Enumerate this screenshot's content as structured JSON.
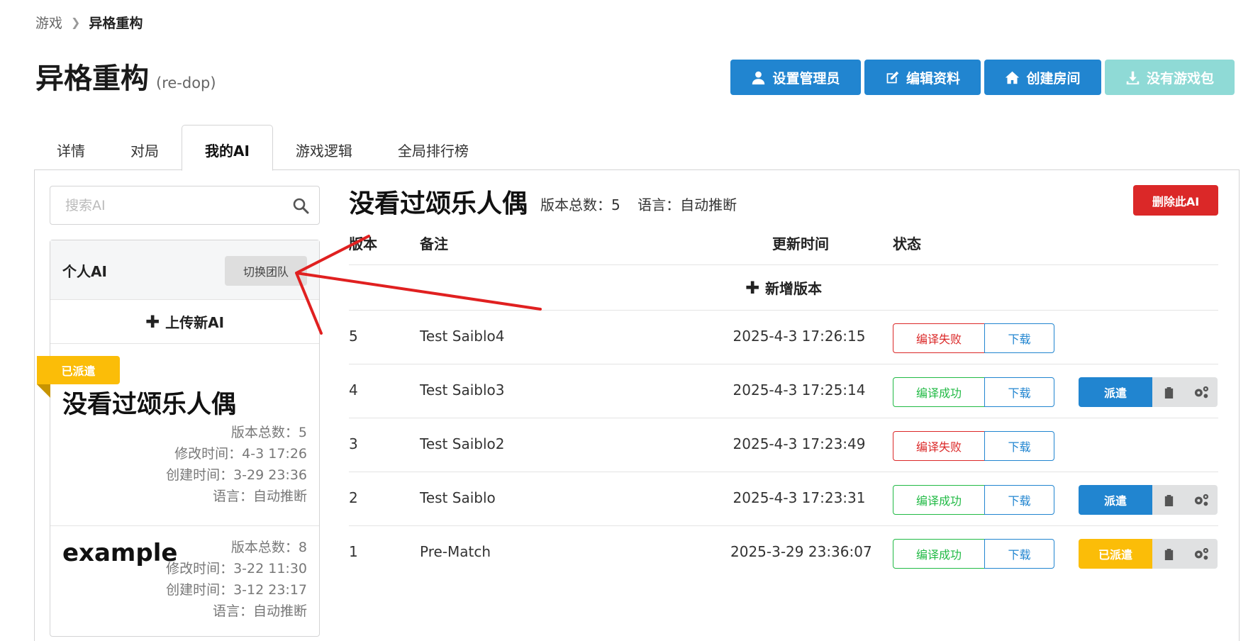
{
  "breadcrumb": {
    "parent": "游戏",
    "current": "异格重构"
  },
  "header": {
    "title": "异格重构",
    "code": "(re-dop)"
  },
  "actions": {
    "set_admin": "设置管理员",
    "edit_profile": "编辑资料",
    "create_room": "创建房间",
    "no_package": "没有游戏包"
  },
  "tabs": [
    "详情",
    "对局",
    "我的AI",
    "游戏逻辑",
    "全局排行榜"
  ],
  "active_tab": "我的AI",
  "sidebar": {
    "search_placeholder": "搜索AI",
    "list_title": "个人AI",
    "switch_team": "切换团队",
    "upload_new": "上传新AI",
    "items": [
      {
        "badge": "已派遣",
        "name": "没看过颂乐人偶",
        "versions": "版本总数：5",
        "modified": "修改时间：4-3 17:26",
        "created": "创建时间：3-29 23:36",
        "language": "语言：自动推断"
      },
      {
        "name": "example",
        "versions": "版本总数：8",
        "modified": "修改时间：3-22 11:30",
        "created": "创建时间：3-12 23:17",
        "language": "语言：自动推断"
      }
    ]
  },
  "detail": {
    "title": "没看过颂乐人偶",
    "version_count": "版本总数：5",
    "language": "语言：自动推断",
    "delete": "删除此AI",
    "columns": {
      "version": "版本",
      "note": "备注",
      "updated": "更新时间",
      "status": "状态"
    },
    "add_version": "新增版本",
    "rows": [
      {
        "version": "5",
        "note": "Test Saiblo4",
        "time": "2025-4-3 17:26:15",
        "status": "编译失败",
        "download": "下载"
      },
      {
        "version": "4",
        "note": "Test Saiblo3",
        "time": "2025-4-3 17:25:14",
        "status": "编译成功",
        "download": "下载",
        "deploy": "派遣"
      },
      {
        "version": "3",
        "note": "Test Saiblo2",
        "time": "2025-4-3 17:23:49",
        "status": "编译失败",
        "download": "下载"
      },
      {
        "version": "2",
        "note": "Test Saiblo",
        "time": "2025-4-3 17:23:31",
        "status": "编译成功",
        "download": "下载",
        "deploy": "派遣"
      },
      {
        "version": "1",
        "note": "Pre-Match",
        "time": "2025-3-29 23:36:07",
        "status": "编译成功",
        "download": "下载",
        "deploy": "已派遣"
      }
    ]
  },
  "colors": {
    "primary": "#2185d0",
    "danger": "#db2828",
    "success": "#21ba45",
    "warning": "#fbbd08",
    "disabled_teal": "#8fdad6",
    "annotation_arrow": "#e02020"
  }
}
